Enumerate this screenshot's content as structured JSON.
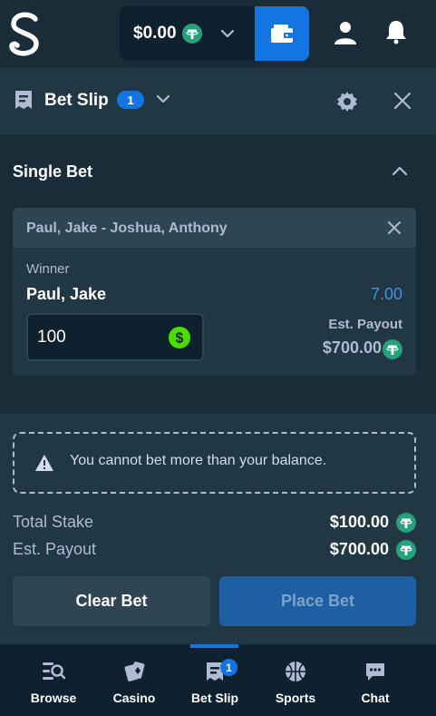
{
  "header": {
    "balance": "$0.00",
    "currency_icon": "tether-coin-icon"
  },
  "bet_slip": {
    "title": "Bet Slip",
    "count": "1"
  },
  "section": {
    "title": "Single Bet"
  },
  "bet": {
    "event": "Paul, Jake - Joshua, Anthony",
    "market": "Winner",
    "selection": "Paul, Jake",
    "odds": "7.00",
    "stake_value": "100",
    "payout_label": "Est. Payout",
    "payout_value": "$700.00"
  },
  "warning": {
    "text": "You cannot bet more than your balance."
  },
  "summary": {
    "total_stake_label": "Total Stake",
    "total_stake_value": "$100.00",
    "est_payout_label": "Est. Payout",
    "est_payout_value": "$700.00"
  },
  "buttons": {
    "clear": "Clear Bet",
    "place": "Place Bet"
  },
  "nav": {
    "items": [
      {
        "label": "Browse",
        "icon": "browse-icon"
      },
      {
        "label": "Casino",
        "icon": "casino-icon"
      },
      {
        "label": "Bet Slip",
        "icon": "bet-slip-icon",
        "badge": "1",
        "active": true
      },
      {
        "label": "Sports",
        "icon": "sports-icon"
      },
      {
        "label": "Chat",
        "icon": "chat-icon"
      }
    ]
  },
  "colors": {
    "background": "#1a2c38",
    "panel": "#213743",
    "accent": "#1475e1",
    "odds": "#4391e7",
    "tether": "#26a17b",
    "dollar": "#4ade00"
  }
}
